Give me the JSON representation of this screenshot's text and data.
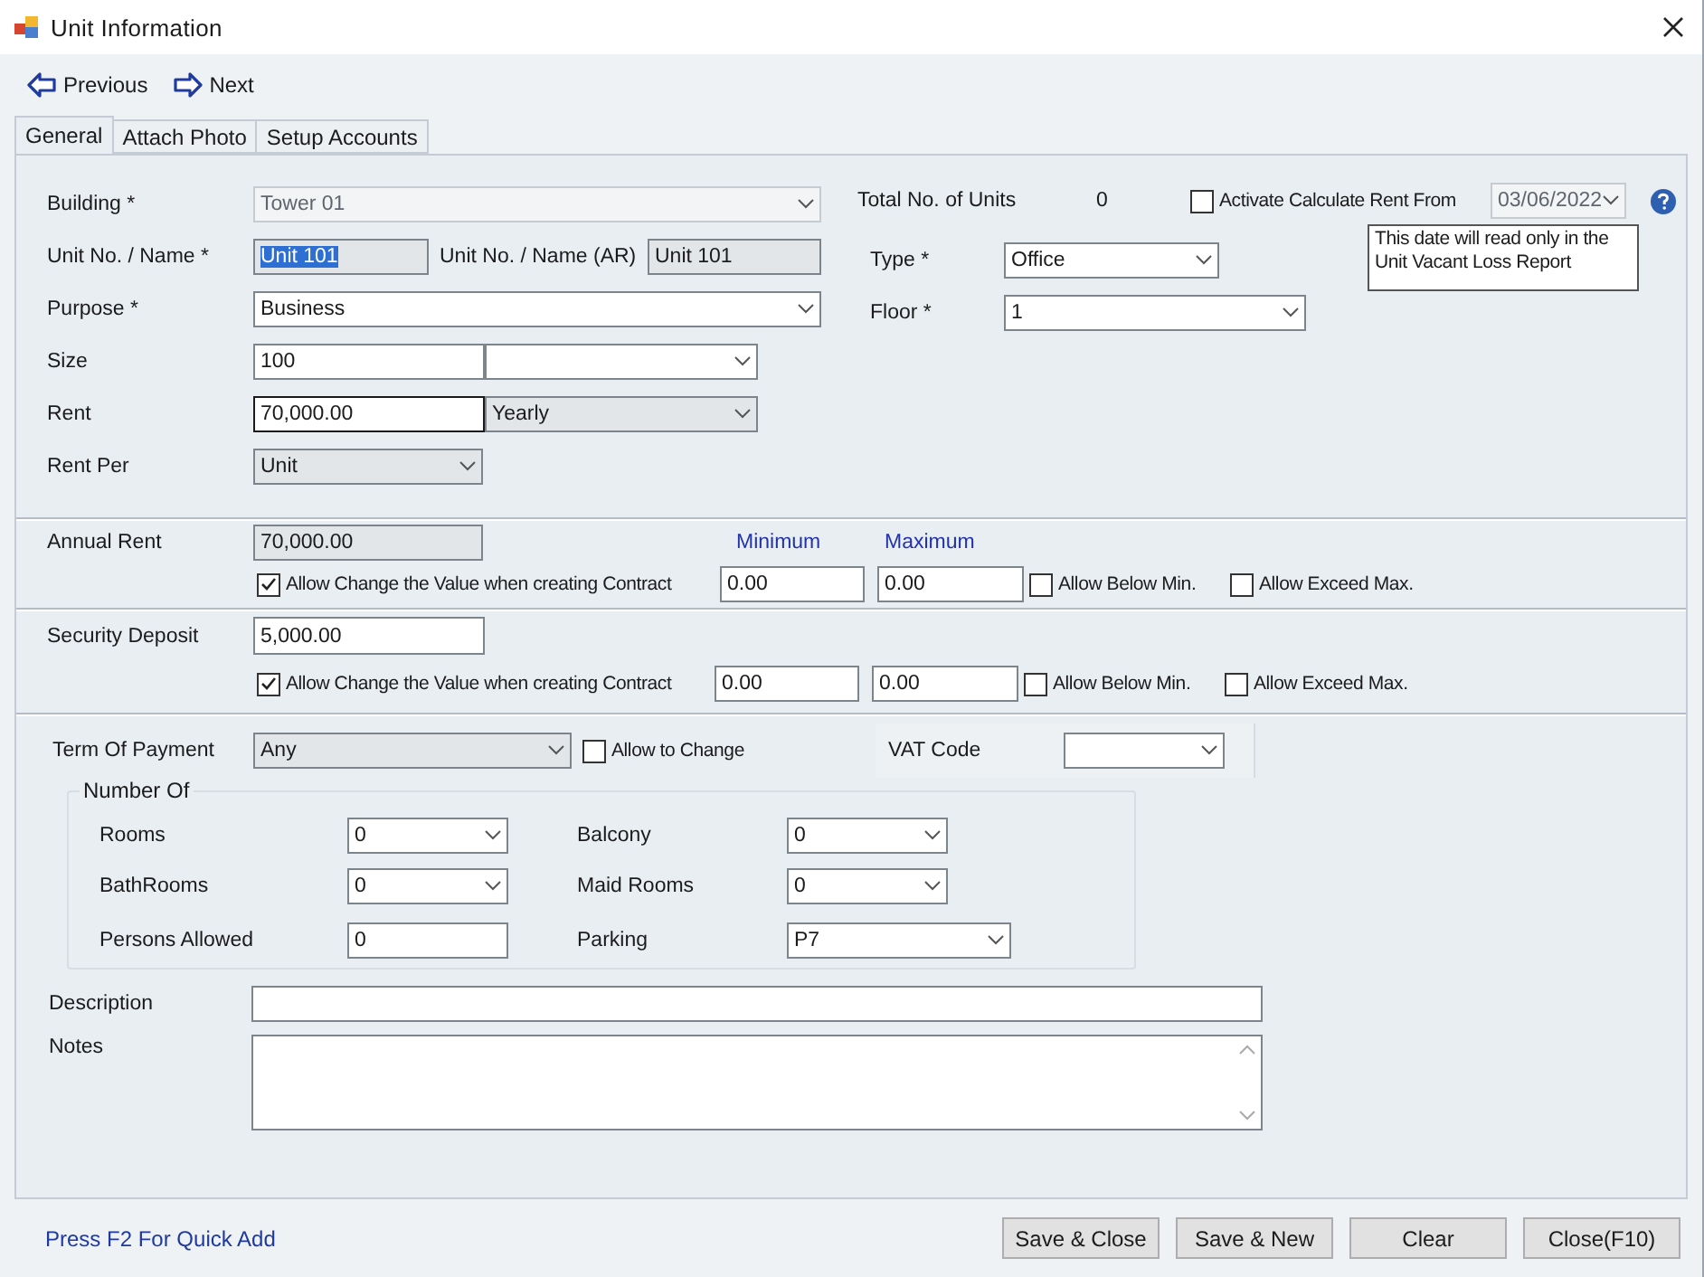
{
  "window": {
    "title": "Unit Information"
  },
  "toolbar": [
    {
      "kind": "previous",
      "label": "Previous"
    },
    {
      "kind": "next",
      "label": "Next"
    }
  ],
  "tabs": [
    {
      "label": "General",
      "selected": true
    },
    {
      "label": "Attach Photo",
      "selected": false
    },
    {
      "label": "Setup Accounts",
      "selected": false
    }
  ],
  "general": {
    "building": {
      "label": "Building *",
      "value": "Tower 01",
      "disabled": true
    },
    "total_units": {
      "label": "Total No. of Units",
      "value": "0"
    },
    "activate_rent": {
      "label": "Activate Calculate Rent From",
      "checked": false
    },
    "rent_from_date": {
      "value": "03/06/2022",
      "disabled": true
    },
    "date_note": "This date will read only in the Unit Vacant Loss Report",
    "unit_name": {
      "label": "Unit No. / Name *",
      "value": "Unit 101",
      "readonly": true,
      "highlighted": true
    },
    "unit_name_ar": {
      "label": "Unit No. / Name (AR)",
      "value": "Unit 101",
      "readonly": true
    },
    "type": {
      "label": "Type *",
      "value": "Office"
    },
    "purpose": {
      "label": "Purpose *",
      "value": "Business"
    },
    "floor": {
      "label": "Floor *",
      "value": "1"
    },
    "size": {
      "label": "Size",
      "value": "100"
    },
    "rent": {
      "label": "Rent",
      "value": "70,000.00",
      "focused": true
    },
    "rent_period": {
      "value": "Yearly",
      "readonly": true
    },
    "rent_per": {
      "label": "Rent Per",
      "value": "Unit",
      "readonly": true
    }
  },
  "annual_rent": {
    "label": "Annual Rent",
    "value": "70,000.00",
    "readonly": true,
    "minimum_label": "Minimum",
    "maximum_label": "Maximum",
    "allow_change": {
      "label": "Allow Change the Value when creating Contract",
      "checked": true
    },
    "minimum": "0.00",
    "maximum": "0.00",
    "allow_below_min": {
      "label": "Allow Below Min.",
      "checked": false
    },
    "allow_exceed_max": {
      "label": "Allow Exceed Max.",
      "checked": false
    }
  },
  "security_deposit": {
    "label": "Security Deposit",
    "value": "5,000.00",
    "allow_change": {
      "label": "Allow Change the Value when creating Contract",
      "checked": true
    },
    "minimum": "0.00",
    "maximum": "0.00",
    "allow_below_min": {
      "label": "Allow Below Min.",
      "checked": false
    },
    "allow_exceed_max": {
      "label": "Allow Exceed Max.",
      "checked": false
    }
  },
  "term_of_payment": {
    "label": "Term Of Payment",
    "value": "Any",
    "readonly": true,
    "allow_change": {
      "label": "Allow to Change",
      "checked": false
    }
  },
  "vat_code": {
    "label": "VAT Code"
  },
  "number_of": {
    "title": "Number Of",
    "rows": [
      {
        "left": {
          "label": "Rooms",
          "value": "0",
          "kind": "dropdown"
        },
        "right": {
          "label": "Balcony",
          "value": "0",
          "kind": "dropdown"
        }
      },
      {
        "left": {
          "label": "BathRooms",
          "value": "0",
          "kind": "dropdown"
        },
        "right": {
          "label": "Maid Rooms",
          "value": "0",
          "kind": "dropdown"
        }
      },
      {
        "left": {
          "label": "Persons Allowed",
          "value": "0",
          "kind": "text"
        },
        "right": {
          "label": "Parking",
          "value": "P7",
          "kind": "dropdown"
        }
      }
    ]
  },
  "description": {
    "label": "Description"
  },
  "notes": {
    "label": "Notes"
  },
  "footer": {
    "hint": "Press F2 For Quick Add",
    "buttons": [
      "Save & Close",
      "Save & New",
      "Clear",
      "Close(F10)"
    ]
  }
}
